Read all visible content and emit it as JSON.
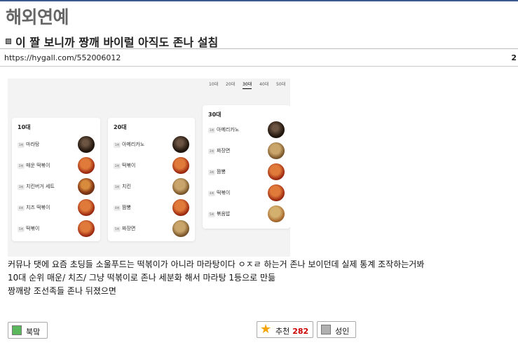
{
  "category": "해외연예",
  "post": {
    "title": "이 짤 보니까 짱깨 바이럴 아직도 존나 설침",
    "url": "https://hygall.com/552006012",
    "url_edge": "2"
  },
  "infographic": {
    "tabs": [
      "10대",
      "20대",
      "30대",
      "40대",
      "50대"
    ],
    "active_tab": "30대",
    "cards": [
      {
        "title": "10대",
        "items": [
          {
            "rank": "1위",
            "name": "마라탕",
            "icon": "mala-soup-photo"
          },
          {
            "rank": "2위",
            "name": "매운 떡볶이",
            "icon": "tteokbokki-photo"
          },
          {
            "rank": "3위",
            "name": "치킨버거 세트",
            "icon": "burger-photo"
          },
          {
            "rank": "4위",
            "name": "치즈 떡볶이",
            "icon": "cheese-tteokbokki-photo"
          },
          {
            "rank": "5위",
            "name": "떡볶이",
            "icon": "tteokbokki-photo"
          }
        ]
      },
      {
        "title": "20대",
        "items": [
          {
            "rank": "1위",
            "name": "아메리카노",
            "icon": "coffee-photo"
          },
          {
            "rank": "2위",
            "name": "떡볶이",
            "icon": "tteokbokki-photo"
          },
          {
            "rank": "3위",
            "name": "치킨",
            "icon": "chicken-photo"
          },
          {
            "rank": "4위",
            "name": "짬뽕",
            "icon": "jjamppong-photo"
          },
          {
            "rank": "5위",
            "name": "짜장면",
            "icon": "jjajangmyeon-photo"
          }
        ]
      },
      {
        "title": "30대",
        "items": [
          {
            "rank": "1위",
            "name": "아메리카노",
            "icon": "coffee-photo"
          },
          {
            "rank": "2위",
            "name": "짜장면",
            "icon": "jjajangmyeon-photo"
          },
          {
            "rank": "3위",
            "name": "짬뽕",
            "icon": "jjamppong-photo"
          },
          {
            "rank": "4위",
            "name": "떡볶이",
            "icon": "tteokbokki-photo"
          },
          {
            "rank": "5위",
            "name": "볶음밥",
            "icon": "fried-rice-photo"
          }
        ]
      }
    ]
  },
  "body_lines": [
    "커뮤나 댓에 요즘 초딩들 소울푸드는 떡볶이가 아니라 마라탕이다 ㅇㅈㄹ 하는거 존나 보이던데 실제 통계 조작하는거봐",
    "10대 순위 매운/ 치즈/ 그냥 떡볶이로 존나 세분화 해서 마라탕 1등으로 만듦",
    "짱깨랑 조선족들 존나 뒤졌으면"
  ],
  "actions": {
    "bookmark_label": "북맠",
    "recommend_label": "추천",
    "recommend_count": "282",
    "adult_label": "성인"
  },
  "colors": {
    "accent_line": "#3a5b8c",
    "bookmark_square": "#5cb85c",
    "adult_square": "#b0b0b0",
    "count_red": "#cc0000"
  }
}
